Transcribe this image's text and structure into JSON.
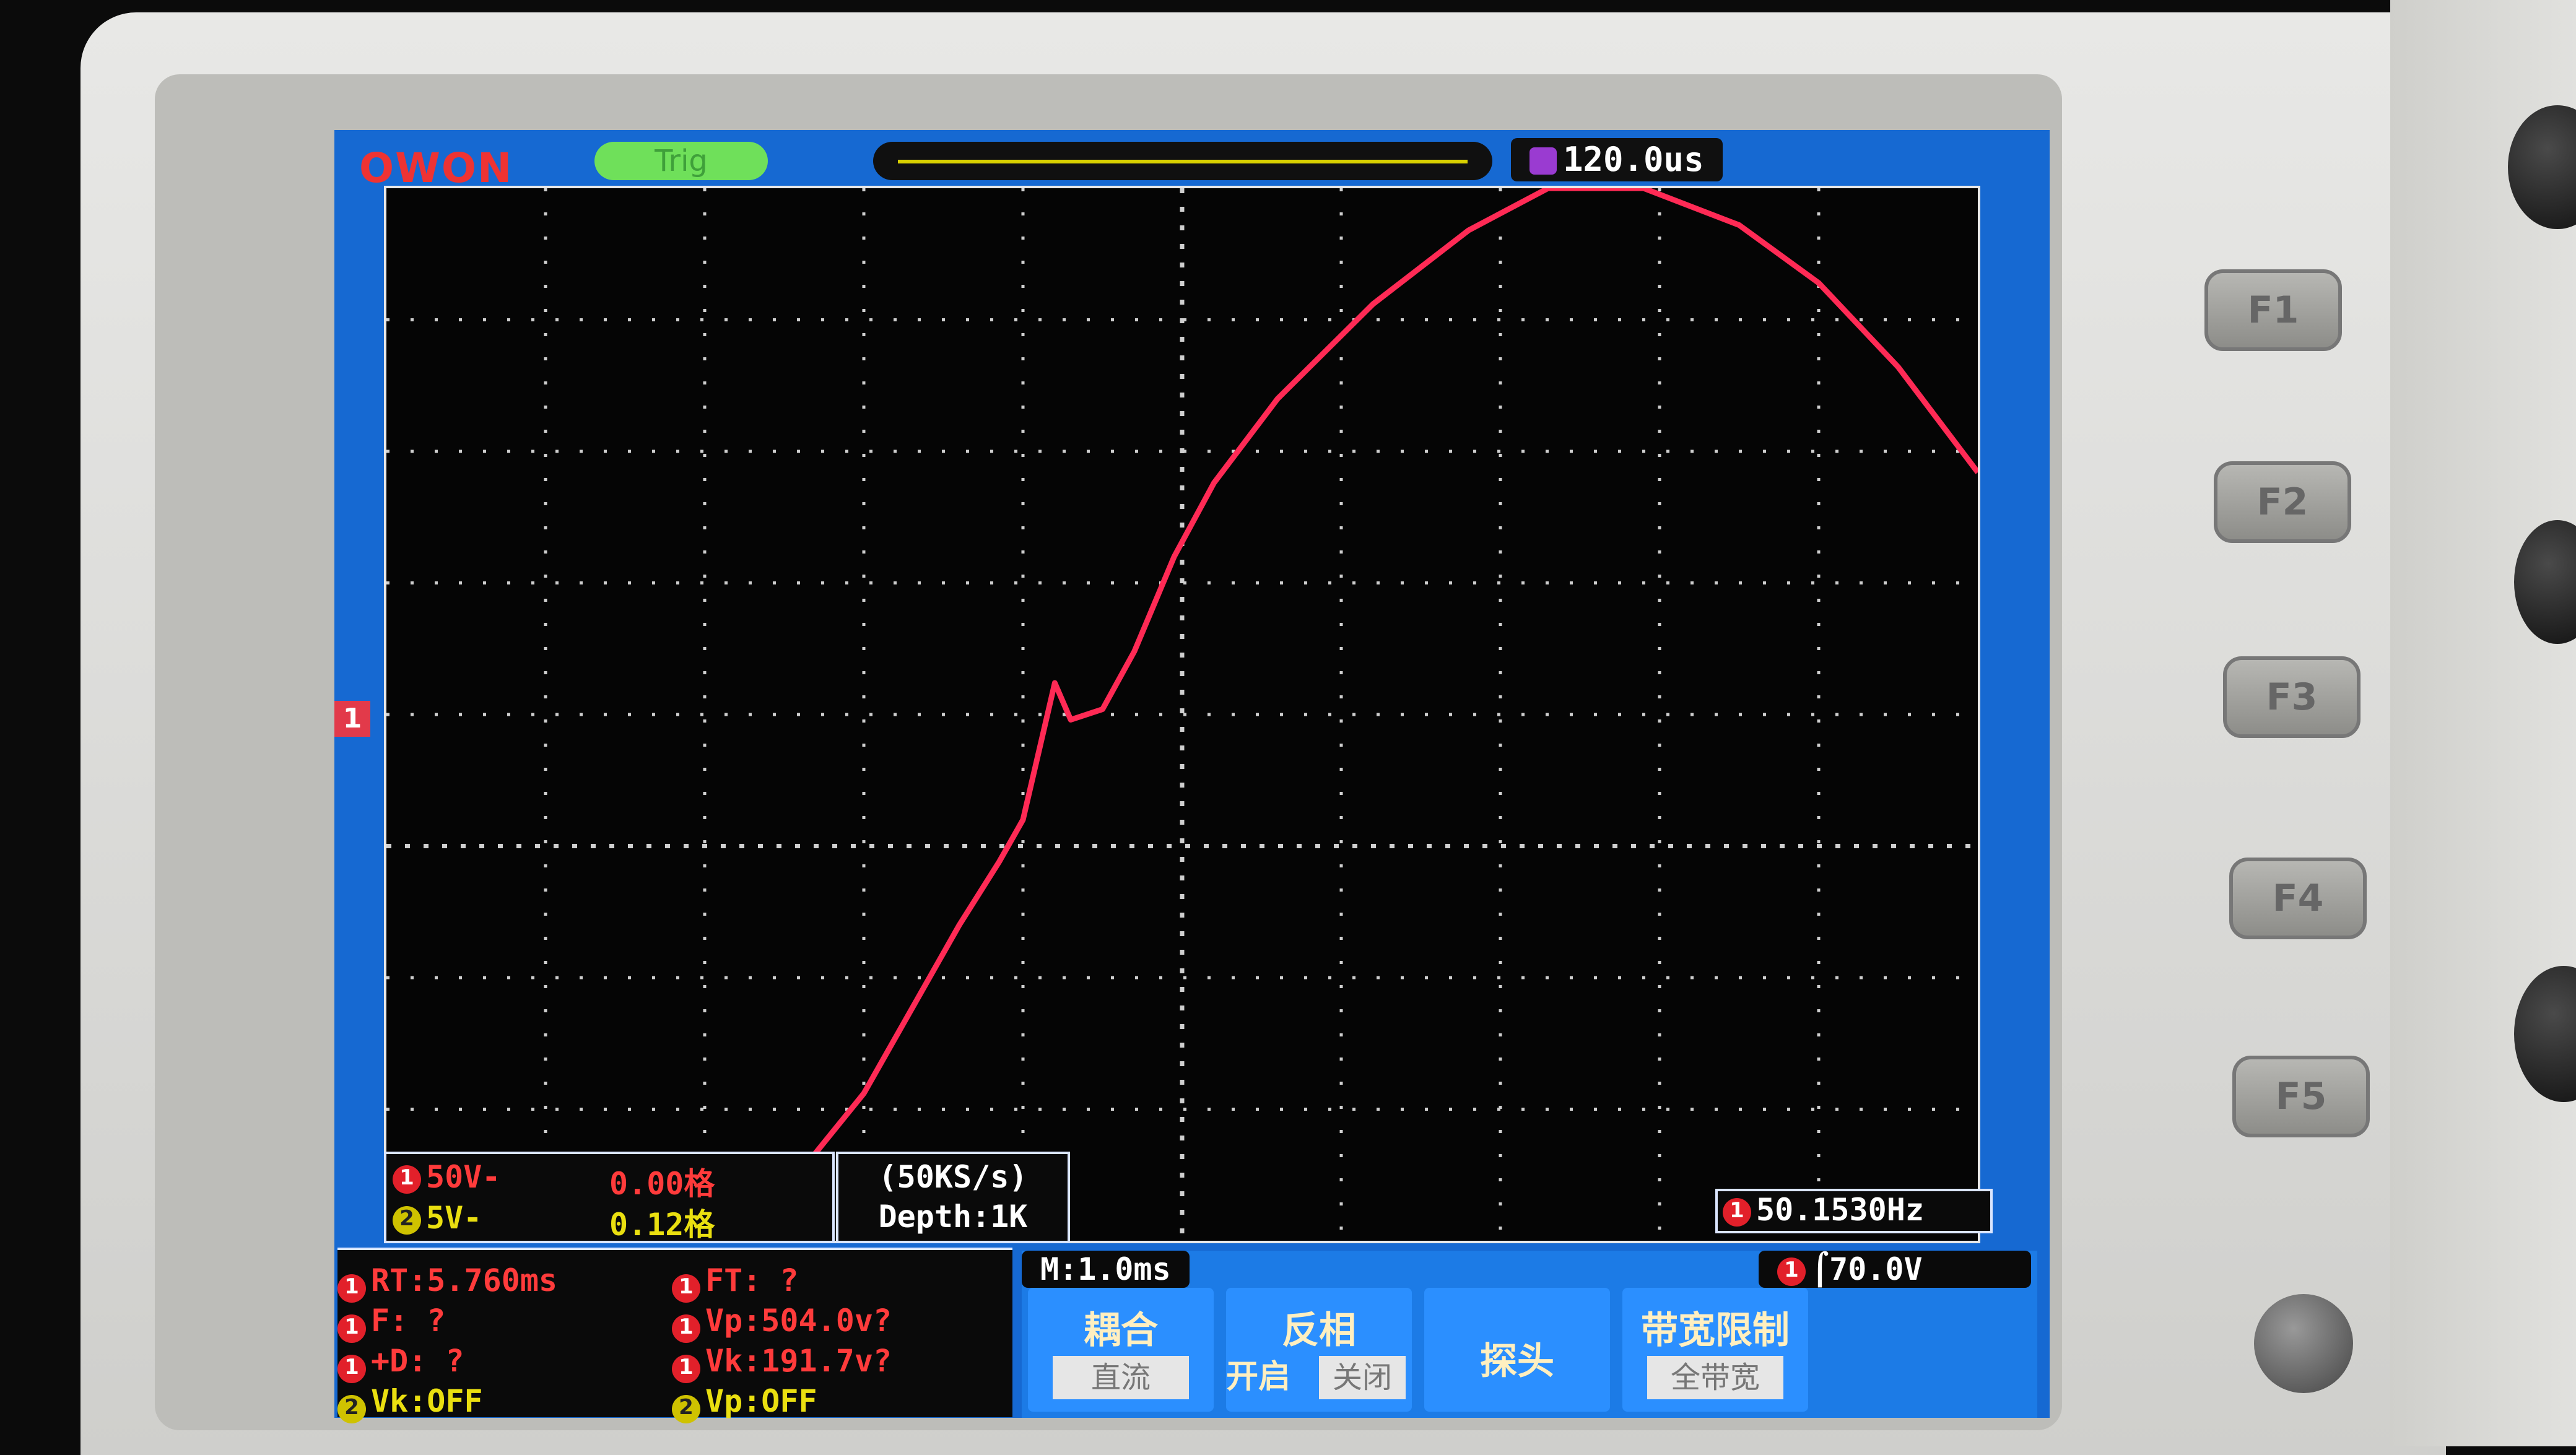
{
  "header": {
    "logo": "OWON",
    "trigger_status": "Trig",
    "trigger_position": "120.0us"
  },
  "channel_marker": "1",
  "channels": [
    {
      "badge": "1",
      "label": "50V-",
      "position": "0.00格"
    },
    {
      "badge": "2",
      "label": "5V-",
      "position": "0.12格"
    }
  ],
  "acquisition": {
    "rate": "(50KS/s)",
    "depth": "Depth:1K"
  },
  "frequency": {
    "badge": "1",
    "value": "50.1530Hz"
  },
  "timebase": "M:1.0ms",
  "trigger": {
    "badge": "1",
    "level": "70.0V"
  },
  "measurements": {
    "left": [
      {
        "badge": "1",
        "text": "RT:5.760ms"
      },
      {
        "badge": "1",
        "text": "F:  ?"
      },
      {
        "badge": "1",
        "text": "+D:  ?"
      },
      {
        "badge": "2",
        "text": "Vk:OFF"
      }
    ],
    "right": [
      {
        "badge": "1",
        "text": "FT:  ?"
      },
      {
        "badge": "1",
        "text": "Vp:504.0v?"
      },
      {
        "badge": "1",
        "text": "Vk:191.7v?"
      },
      {
        "badge": "2",
        "text": "Vp:OFF"
      }
    ]
  },
  "menu": [
    {
      "label": "耦合",
      "value": "直流"
    },
    {
      "label": "反相",
      "prefix": "开启",
      "value": "关闭"
    },
    {
      "label": "探头",
      "value": ""
    },
    {
      "label": "带宽限制",
      "value": "全带宽"
    }
  ],
  "function_keys": [
    "F1",
    "F2",
    "F3",
    "F4",
    "F5"
  ],
  "trace_color": "#ff2a55"
}
